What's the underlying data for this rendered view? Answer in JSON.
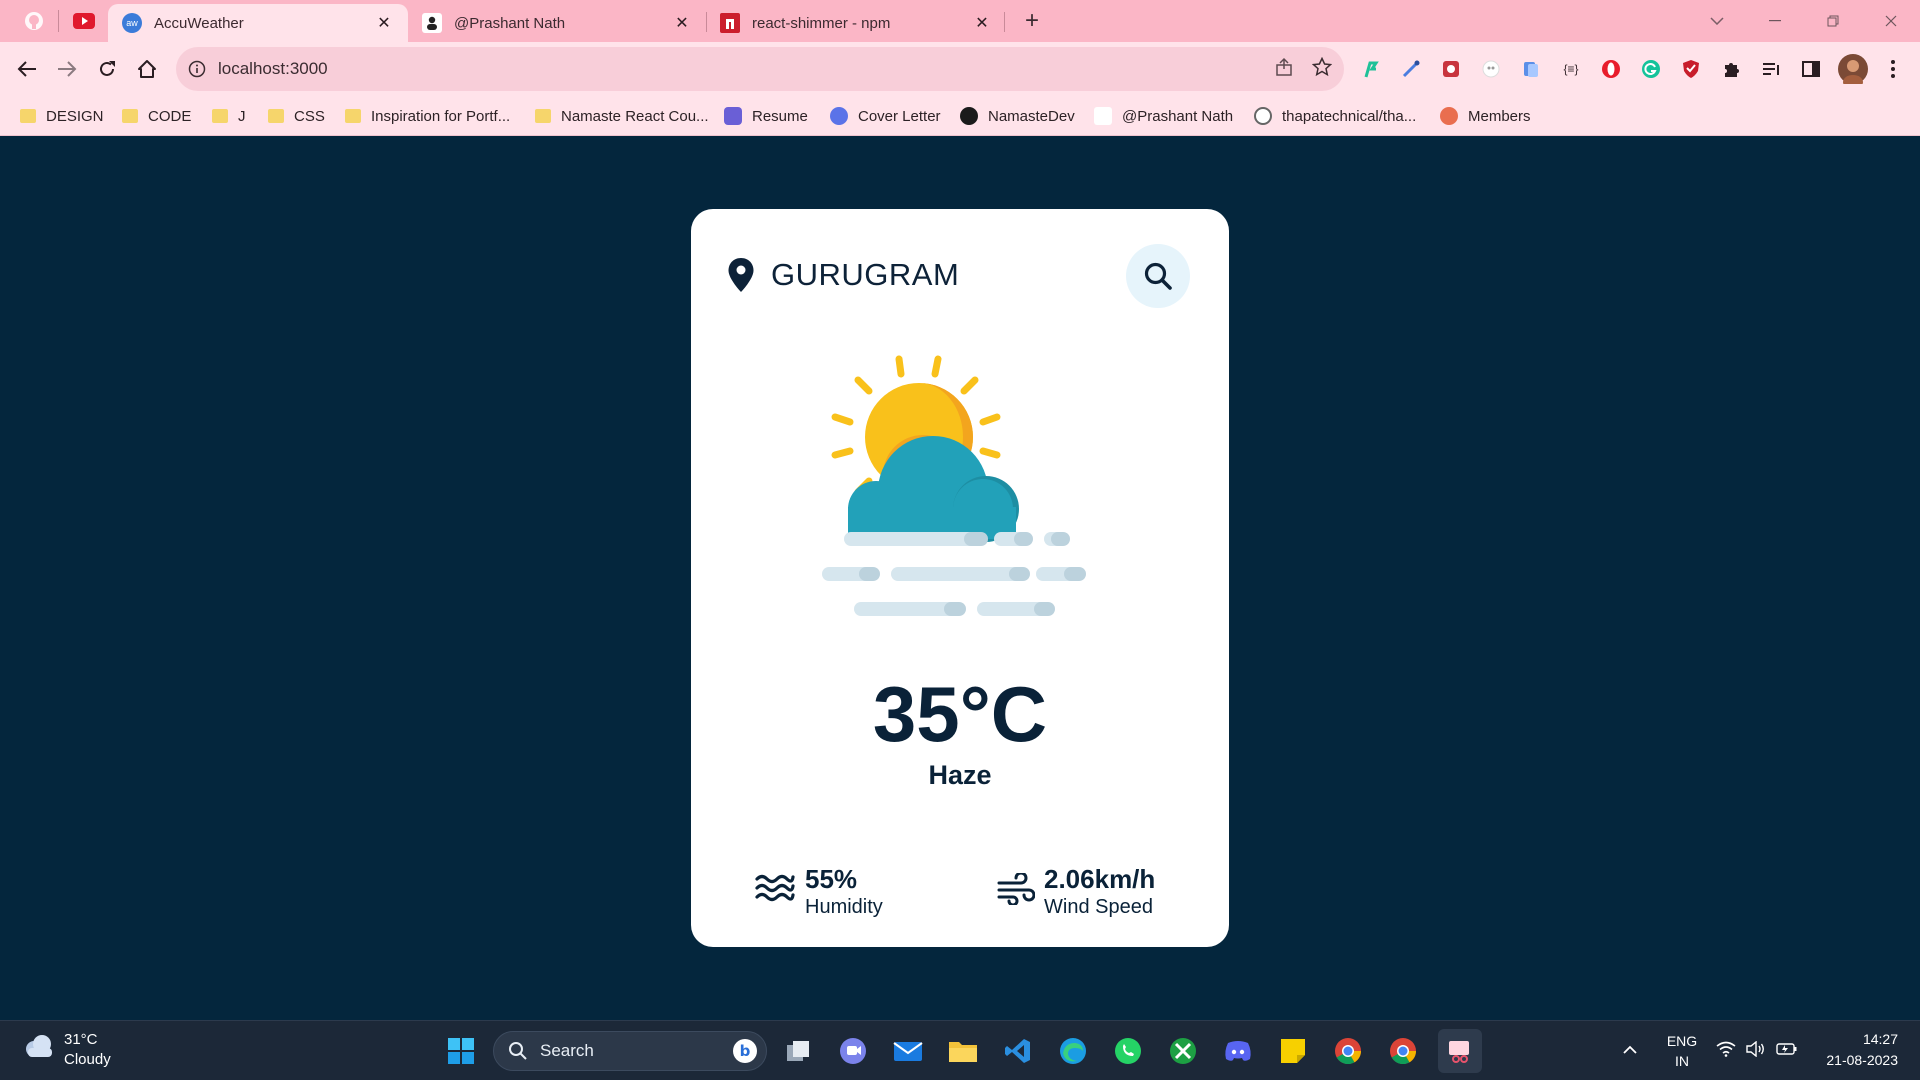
{
  "browser": {
    "tabs": [
      {
        "title": "AccuWeather",
        "favicon": "accuweather-icon",
        "active": true
      },
      {
        "title": "@Prashant Nath",
        "favicon": "user-avatar-icon",
        "active": false
      },
      {
        "title": "react-shimmer - npm",
        "favicon": "npm-icon",
        "active": false
      }
    ],
    "pinned_tabs": [
      "github-icon",
      "youtube-icon"
    ],
    "url": "localhost:3000",
    "bookmarks": [
      {
        "label": "DESIGN",
        "icon": "folder-icon"
      },
      {
        "label": "CODE",
        "icon": "folder-icon"
      },
      {
        "label": "J",
        "icon": "folder-icon"
      },
      {
        "label": "CSS",
        "icon": "folder-icon"
      },
      {
        "label": "Inspiration for Portf...",
        "icon": "folder-icon"
      },
      {
        "label": "Namaste React Cou...",
        "icon": "folder-icon"
      },
      {
        "label": "Resume",
        "icon": "resume-icon"
      },
      {
        "label": "Cover Letter",
        "icon": "canva-icon"
      },
      {
        "label": "NamasteDev",
        "icon": "namastedev-icon"
      },
      {
        "label": "@Prashant Nath",
        "icon": "user-avatar-icon"
      },
      {
        "label": "thapatechnical/tha...",
        "icon": "github-icon"
      },
      {
        "label": "Members",
        "icon": "members-icon"
      }
    ]
  },
  "weather": {
    "city": "GURUGRAM",
    "temperature": "35°C",
    "condition": "Haze",
    "humidity_value": "55%",
    "humidity_label": "Humidity",
    "wind_value": "2.06km/h",
    "wind_label": "Wind Speed",
    "icon": "sun-cloud-haze-icon"
  },
  "taskbar": {
    "weather_temp": "31°C",
    "weather_cond": "Cloudy",
    "search_label": "Search",
    "lang_line1": "ENG",
    "lang_line2": "IN",
    "time": "14:27",
    "date": "21-08-2023"
  },
  "colors": {
    "page_bg": "#04263d",
    "card_bg": "#ffffff",
    "text_dark": "#0a2238",
    "tab_strip": "#fbb6c6",
    "toolbar": "#ffe3ea",
    "sun": "#f9c11b",
    "cloud": "#22a1b9",
    "haze": "#d6e6ee"
  }
}
